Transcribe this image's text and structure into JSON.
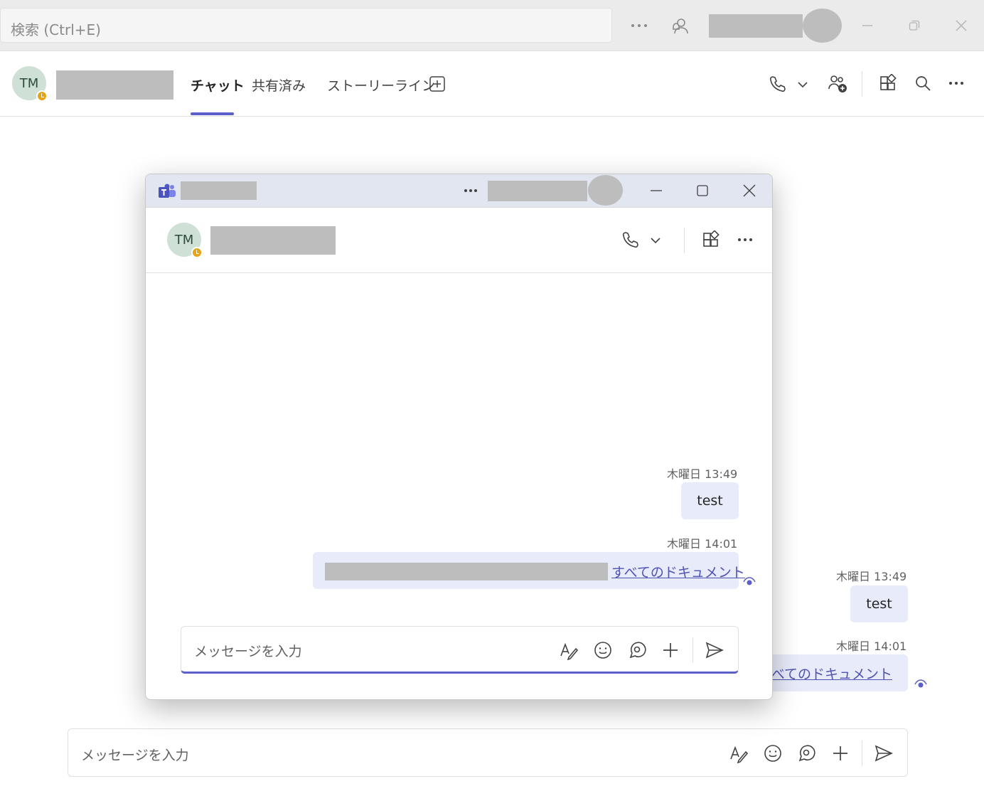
{
  "titlebar": {
    "search_placeholder": "検索 (Ctrl+E)",
    "more_label": "···"
  },
  "chat_header": {
    "avatar_initials": "TM",
    "tabs": [
      {
        "label": "チャット",
        "active": true
      },
      {
        "label": "共有済み",
        "active": false
      },
      {
        "label": "ストーリーライン",
        "active": false
      }
    ]
  },
  "main_messages": [
    {
      "timestamp": "木曜日 13:49",
      "text": "test"
    },
    {
      "timestamp": "木曜日 14:01",
      "link_text": "- すべてのドキュメント"
    }
  ],
  "compose": {
    "placeholder": "メッセージを入力"
  },
  "popout": {
    "avatar_initials": "TM",
    "messages": [
      {
        "timestamp": "木曜日 13:49",
        "text": "test"
      },
      {
        "timestamp": "木曜日 14:01",
        "link_text": "すべてのドキュメント"
      }
    ],
    "compose_placeholder": "メッセージを入力"
  },
  "colors": {
    "accent": "#5b5fc7",
    "bubble": "#e8ebfa",
    "presence_away": "#e8a317",
    "link": "#4f52b2"
  }
}
